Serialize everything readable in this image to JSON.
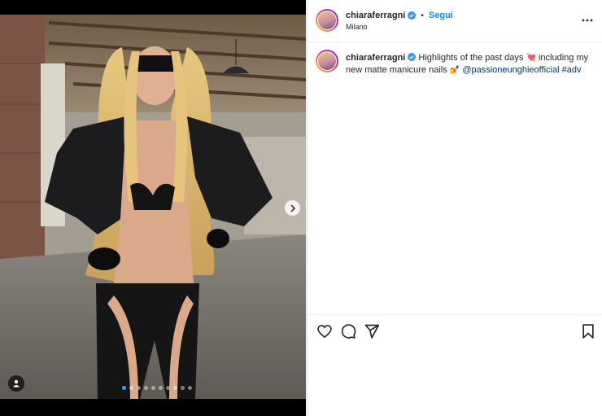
{
  "post": {
    "username": "chiaraferragni",
    "follow_label": "Segui",
    "separator": "•",
    "location": "Milano",
    "more_label": "⋯",
    "caption": {
      "username": "chiaraferragni",
      "text_before": "Highlights of the past days",
      "emoji_heart": "💘",
      "text_mid": "including my new matte manicure nails",
      "emoji_nails": "💅",
      "mention": "@passioneunghieofficial",
      "hashtag": "#adv"
    }
  },
  "media": {
    "carousel_count": 10,
    "active_index": 0,
    "icons": [
      "chevron-right-icon",
      "person-tag-icon"
    ]
  },
  "actions": {
    "icons": [
      "heart-icon",
      "comment-icon",
      "share-icon",
      "bookmark-icon"
    ]
  },
  "colors": {
    "accent": "#0095f6",
    "link": "#00376b",
    "active_dot": "#3aa0ff"
  }
}
